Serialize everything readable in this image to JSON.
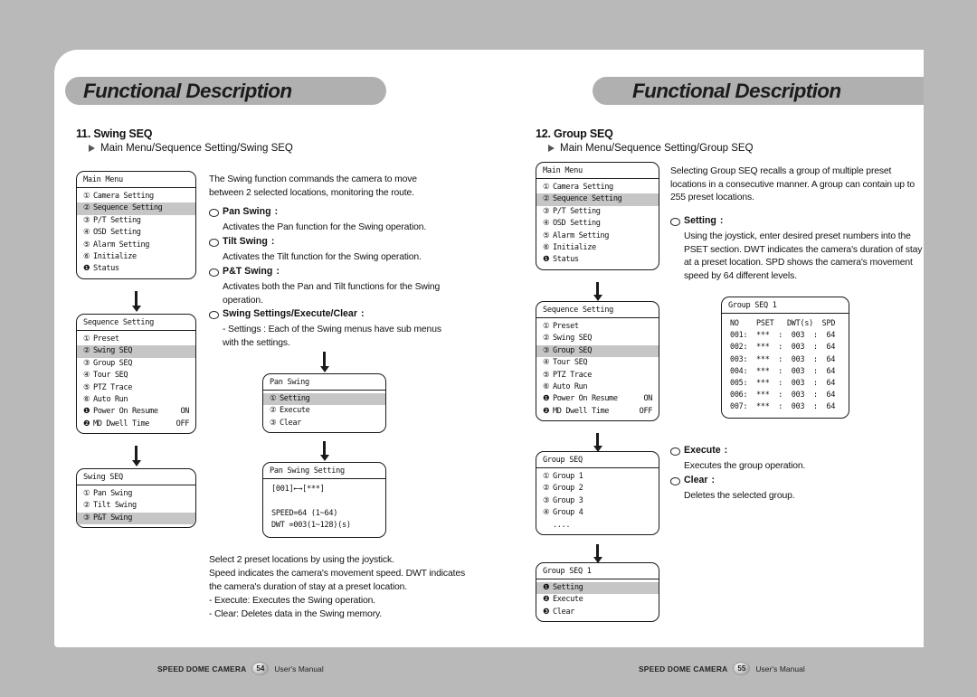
{
  "banner": {
    "left_title": "Functional Description",
    "right_title": "Functional Description"
  },
  "left_page": {
    "section_number_title": "11. Swing SEQ",
    "path": "Main Menu/Sequence Setting/Swing SEQ",
    "intro": "The Swing function commands the camera to move between 2 selected locations, monitoring the route.",
    "bullets": [
      {
        "label": "Pan Swing",
        "colon": ":",
        "body": "Activates the Pan function for the Swing operation."
      },
      {
        "label": "Tilt Swing",
        "colon": ":",
        "body": "Activates the Tilt function for the Swing operation."
      },
      {
        "label": "P&T Swing",
        "colon": ":",
        "body": "Activates both the Pan and Tilt functions for the Swing operation."
      },
      {
        "label": "Swing Settings/Execute/Clear",
        "colon": ":",
        "body": "- Settings : Each of the Swing menus have sub menus with the settings."
      }
    ],
    "closing": [
      "Select 2 preset locations by using the joystick.",
      "Speed indicates the camera's movement speed. DWT indicates the camera's duration of stay at a preset location.",
      "- Execute: Executes the Swing operation.",
      "- Clear: Deletes data in the Swing memory."
    ],
    "menus": {
      "main_menu": {
        "title": "Main Menu",
        "items": [
          {
            "num": "①",
            "label": "Camera Setting",
            "value": "",
            "selected": false
          },
          {
            "num": "②",
            "label": "Sequence Setting",
            "value": "",
            "selected": true
          },
          {
            "num": "③",
            "label": "P/T Setting",
            "value": "",
            "selected": false
          },
          {
            "num": "④",
            "label": "OSD Setting",
            "value": "",
            "selected": false
          },
          {
            "num": "⑤",
            "label": "Alarm Setting",
            "value": "",
            "selected": false
          },
          {
            "num": "⑥",
            "label": "Initialize",
            "value": "",
            "selected": false
          },
          {
            "num": "❶",
            "label": "Status",
            "value": "",
            "selected": false
          }
        ]
      },
      "sequence_setting": {
        "title": "Sequence Setting",
        "items": [
          {
            "num": "①",
            "label": "Preset",
            "value": "",
            "selected": false
          },
          {
            "num": "②",
            "label": "Swing SEQ",
            "value": "",
            "selected": true
          },
          {
            "num": "③",
            "label": "Group SEQ",
            "value": "",
            "selected": false
          },
          {
            "num": "④",
            "label": "Tour SEQ",
            "value": "",
            "selected": false
          },
          {
            "num": "⑤",
            "label": "PTZ Trace",
            "value": "",
            "selected": false
          },
          {
            "num": "⑥",
            "label": "Auto Run",
            "value": "",
            "selected": false
          },
          {
            "num": "❶",
            "label": "Power On Resume",
            "value": "ON",
            "selected": false
          },
          {
            "num": "❷",
            "label": "MD Dwell Time",
            "value": "OFF",
            "selected": false
          }
        ]
      },
      "swing_seq": {
        "title": "Swing SEQ",
        "items": [
          {
            "num": "①",
            "label": "Pan Swing",
            "value": "",
            "selected": false
          },
          {
            "num": "②",
            "label": "Tilt Swing",
            "value": "",
            "selected": false
          },
          {
            "num": "③",
            "label": "P&T Swing",
            "value": "",
            "selected": true
          }
        ]
      },
      "pan_swing": {
        "title": "Pan Swing",
        "items": [
          {
            "num": "①",
            "label": "Setting",
            "value": "",
            "selected": true
          },
          {
            "num": "②",
            "label": "Execute",
            "value": "",
            "selected": false
          },
          {
            "num": "③",
            "label": "Clear",
            "value": "",
            "selected": false
          }
        ]
      },
      "pan_swing_setting": {
        "title": "Pan Swing Setting",
        "lines": [
          "[001]←→[***]",
          "",
          "SPEED=64 (1~64)",
          "DWT =003(1~128)(s)"
        ]
      }
    }
  },
  "right_page": {
    "section_number_title": "12. Group SEQ",
    "path": "Main Menu/Sequence Setting/Group SEQ",
    "intro": "Selecting Group SEQ recalls a group of multiple preset locations in a consecutive manner. A group can contain up to 255 preset locations.",
    "bullets": [
      {
        "label": "Setting",
        "colon": ":",
        "body": "Using the joystick, enter desired preset numbers into the PSET section. DWT indicates the camera's duration of stay at a preset location. SPD shows the camera's movement speed by 64 different levels."
      },
      {
        "label": "Execute",
        "colon": ":",
        "body": "Executes the group operation."
      },
      {
        "label": "Clear",
        "colon": ":",
        "body": "Deletes the selected group."
      }
    ],
    "menus": {
      "main_menu": {
        "title": "Main Menu",
        "items": [
          {
            "num": "①",
            "label": "Camera Setting",
            "value": "",
            "selected": false
          },
          {
            "num": "②",
            "label": "Sequence Setting",
            "value": "",
            "selected": true
          },
          {
            "num": "③",
            "label": "P/T Setting",
            "value": "",
            "selected": false
          },
          {
            "num": "④",
            "label": "OSD Setting",
            "value": "",
            "selected": false
          },
          {
            "num": "⑤",
            "label": "Alarm Setting",
            "value": "",
            "selected": false
          },
          {
            "num": "⑥",
            "label": "Initialize",
            "value": "",
            "selected": false
          },
          {
            "num": "❶",
            "label": "Status",
            "value": "",
            "selected": false
          }
        ]
      },
      "sequence_setting": {
        "title": "Sequence Setting",
        "items": [
          {
            "num": "①",
            "label": "Preset",
            "value": "",
            "selected": false
          },
          {
            "num": "②",
            "label": "Swing SEQ",
            "value": "",
            "selected": false
          },
          {
            "num": "③",
            "label": "Group SEQ",
            "value": "",
            "selected": true
          },
          {
            "num": "④",
            "label": "Tour SEQ",
            "value": "",
            "selected": false
          },
          {
            "num": "⑤",
            "label": "PTZ Trace",
            "value": "",
            "selected": false
          },
          {
            "num": "⑥",
            "label": "Auto Run",
            "value": "",
            "selected": false
          },
          {
            "num": "❶",
            "label": "Power On Resume",
            "value": "ON",
            "selected": false
          },
          {
            "num": "❷",
            "label": "MD Dwell Time",
            "value": "OFF",
            "selected": false
          }
        ]
      },
      "group_seq": {
        "title": "Group SEQ",
        "items": [
          {
            "num": "①",
            "label": "Group 1",
            "value": "",
            "selected": false
          },
          {
            "num": "②",
            "label": "Group 2",
            "value": "",
            "selected": false
          },
          {
            "num": "③",
            "label": "Group 3",
            "value": "",
            "selected": false
          },
          {
            "num": "④",
            "label": "Group 4",
            "value": "",
            "selected": false
          },
          {
            "num": "",
            "label": "....",
            "value": "",
            "selected": false
          }
        ]
      },
      "group_seq_1_menu": {
        "title": "Group SEQ 1",
        "items": [
          {
            "num": "❶",
            "label": "Setting",
            "value": "",
            "selected": true
          },
          {
            "num": "❷",
            "label": "Execute",
            "value": "",
            "selected": false
          },
          {
            "num": "❸",
            "label": "Clear",
            "value": "",
            "selected": false
          }
        ]
      },
      "group_seq_1_table": {
        "title": "Group SEQ 1",
        "header": "NO    PSET   DWT(s)  SPD",
        "rows": [
          "001:  ***  :  003  :  64",
          "002:  ***  :  003  :  64",
          "003:  ***  :  003  :  64",
          "004:  ***  :  003  :  64",
          "005:  ***  :  003  :  64",
          "006:  ***  :  003  :  64",
          "007:  ***  :  003  :  64"
        ]
      }
    }
  },
  "footer": {
    "left": {
      "brand": "SPEED DOME CAMERA",
      "page": "54",
      "manual": "User's Manual"
    },
    "right": {
      "brand": "SPEED DOME CAMERA",
      "page": "55",
      "manual": "User's Manual"
    }
  }
}
